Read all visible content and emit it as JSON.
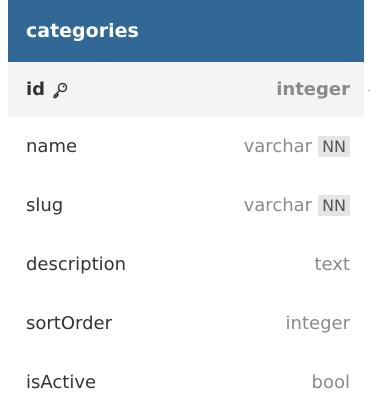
{
  "table": {
    "name": "categories",
    "header_color": "#316896",
    "columns": [
      {
        "name": "id",
        "type": "integer",
        "primary_key": true,
        "icon": "key-icon",
        "badge": ""
      },
      {
        "name": "name",
        "type": "varchar",
        "primary_key": false,
        "badge": "NN"
      },
      {
        "name": "slug",
        "type": "varchar",
        "primary_key": false,
        "badge": "NN"
      },
      {
        "name": "description",
        "type": "text",
        "primary_key": false,
        "badge": ""
      },
      {
        "name": "sortOrder",
        "type": "integer",
        "primary_key": false,
        "badge": ""
      },
      {
        "name": "isActive",
        "type": "bool",
        "primary_key": false,
        "badge": ""
      }
    ]
  }
}
